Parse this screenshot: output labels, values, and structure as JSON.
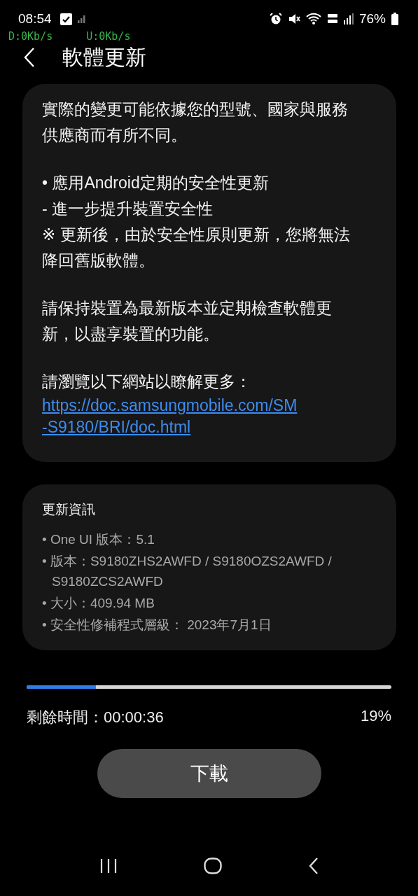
{
  "status_bar": {
    "time": "08:54",
    "battery": "76%"
  },
  "net_speed": {
    "download": "D:0Kb/s",
    "upload": "U:0Kb/s"
  },
  "header": {
    "title": "軟體更新"
  },
  "notes_card": {
    "paragraphs": [
      {
        "lines": [
          "實際的變更可能依據您的型號、國家與服務",
          "供應商而有所不同。"
        ]
      },
      {
        "lines": [
          "• 應用Android定期的安全性更新",
          " - 進一步提升裝置安全性",
          "※ 更新後，由於安全性原則更新，您將無法",
          "降回舊版軟體。"
        ]
      },
      {
        "lines": [
          "請保持裝置為最新版本並定期檢查軟體更",
          "新，以盡享裝置的功能。"
        ]
      },
      {
        "lines": [
          "請瀏覽以下網站以瞭解更多："
        ],
        "link_lines": [
          "https://doc.samsungmobile.com/SM",
          "-S9180/BRI/doc.html"
        ]
      }
    ]
  },
  "info_card": {
    "title": "更新資訊",
    "items": [
      {
        "lines": [
          "• One UI 版本：5.1"
        ]
      },
      {
        "lines": [
          "• 版本：S9180ZHS2AWFD / S9180OZS2AWFD /",
          "S9180ZCS2AWFD"
        ]
      },
      {
        "lines": [
          "• 大小：409.94 MB"
        ]
      },
      {
        "lines": [
          "• 安全性修補程式層級： 2023年7月1日"
        ]
      }
    ]
  },
  "download": {
    "level": 0.19,
    "remaining": "剩餘時間：00:00:36",
    "percent": "19%",
    "button": "下載"
  }
}
